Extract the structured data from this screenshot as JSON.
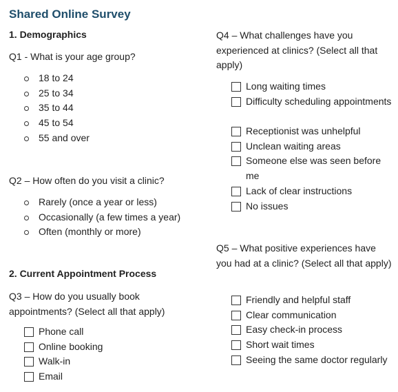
{
  "title": "Shared Online Survey",
  "sections": {
    "demographics": "1. Demographics",
    "appointment": "2. Current Appointment Process"
  },
  "q1": {
    "text": "Q1 - What is your age group?",
    "options": [
      "18 to 24",
      "25 to 34",
      "35 to 44",
      "45 to 54",
      "55 and over"
    ]
  },
  "q2": {
    "text": "Q2 – How often do you visit a clinic?",
    "options": [
      "Rarely (once a year or less)",
      "Occasionally (a few times a year)",
      "Often (monthly or more)"
    ]
  },
  "q3": {
    "text": "Q3 – How do you usually book appointments? (Select all that apply)",
    "options": [
      "Phone call",
      "Online booking",
      "Walk-in",
      "Email"
    ]
  },
  "q4": {
    "text": "Q4 – What challenges have you experienced at clinics? (Select all that apply)",
    "options": [
      "Long waiting times",
      "Difficulty scheduling appointments",
      "Receptionist was unhelpful",
      "Unclean waiting areas",
      "Someone else was seen before me",
      "Lack of clear instructions",
      "No issues"
    ]
  },
  "q5": {
    "text": "Q5 – What positive experiences have you had at a clinic? (Select all that apply)",
    "options": [
      "Friendly and helpful staff",
      "Clear communication",
      "Easy check-in process",
      "Short wait times",
      "Seeing the same doctor regularly"
    ]
  }
}
